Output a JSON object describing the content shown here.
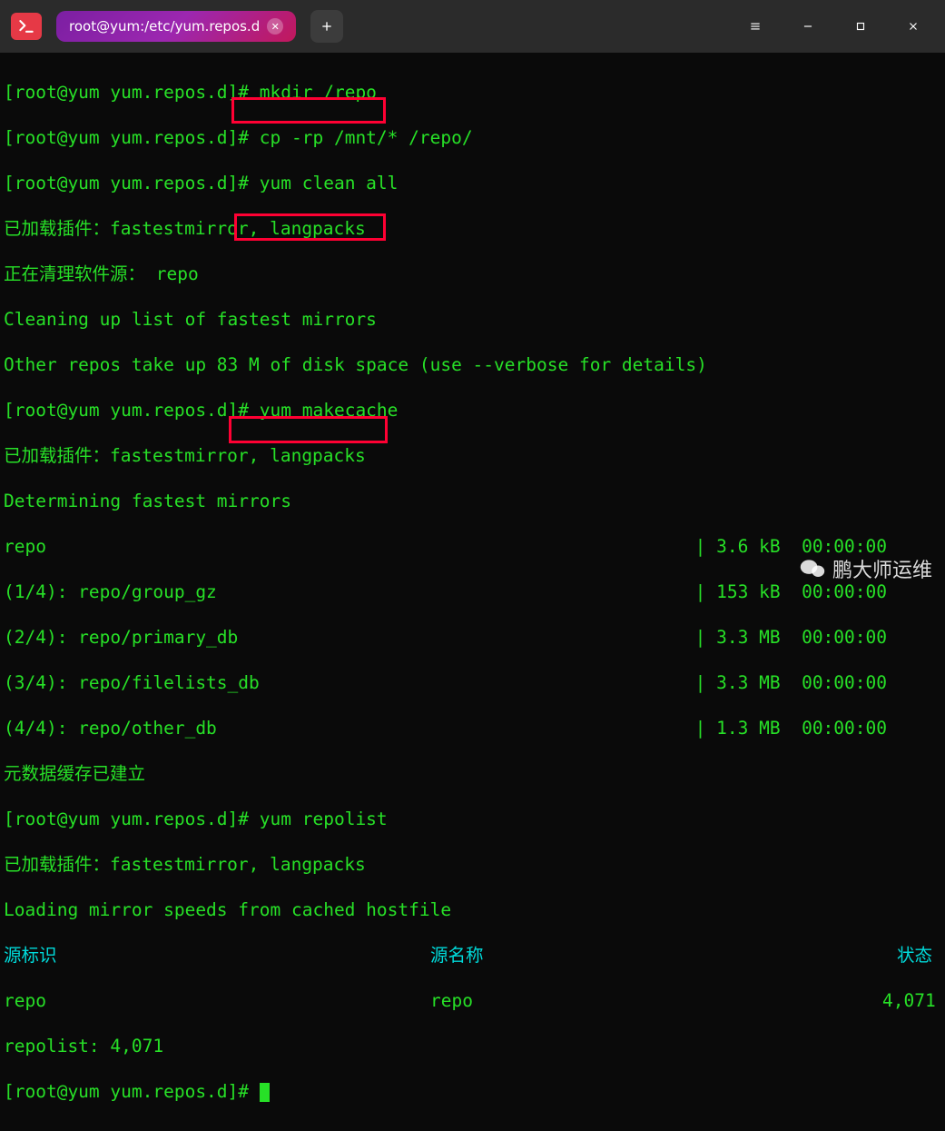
{
  "tab": {
    "title": "root@yum:/etc/yum.repos.d"
  },
  "prompt": "[root@yum yum.repos.d]#",
  "cmds": {
    "mkdir": "mkdir /repo",
    "cp": "cp -rp /mnt/* /repo/",
    "clean": "yum clean all",
    "makecache": "yum makecache",
    "repolist": "yum repolist"
  },
  "out": {
    "loaded_plugins": "已加载插件：fastestmirror, langpacks",
    "cleaning_repo": "正在清理软件源： repo",
    "cleaning_list": "Cleaning up list of fastest mirrors",
    "other_repos": "Other repos take up 83 M of disk space (use --verbose for details)",
    "determining": "Determining fastest mirrors",
    "cache_built": "元数据缓存已建立",
    "loading_mirror": "Loading mirror speeds from cached hostfile"
  },
  "downloads": [
    {
      "name": "repo",
      "size": "3.6 kB",
      "time": "00:00:00"
    },
    {
      "name": "(1/4): repo/group_gz",
      "size": "153 kB",
      "time": "00:00:00"
    },
    {
      "name": "(2/4): repo/primary_db",
      "size": "3.3 MB",
      "time": "00:00:00"
    },
    {
      "name": "(3/4): repo/filelists_db",
      "size": "3.3 MB",
      "time": "00:00:00"
    },
    {
      "name": "(4/4): repo/other_db",
      "size": "1.3 MB",
      "time": "00:00:00"
    }
  ],
  "repolist": {
    "header": {
      "id": "源标识",
      "name": "源名称",
      "status": "状态"
    },
    "row": {
      "id": "repo",
      "name": "repo",
      "status": "4,071"
    },
    "footer": "repolist: 4,071"
  },
  "watermark": "鹏大师运维"
}
